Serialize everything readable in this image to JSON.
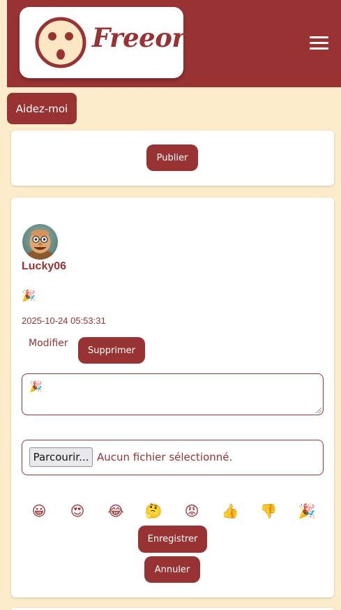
{
  "header": {
    "brand": "Freeora",
    "background": "#993233",
    "menu_icon": "hamburger-icon"
  },
  "help_button": {
    "label": "Aidez-moi"
  },
  "composer": {
    "publish_label": "Publier"
  },
  "post": {
    "username": "Lucky06",
    "content": "🎉",
    "timestamp": "2025-10-24 05:53:31",
    "modify_label": "Modifier",
    "delete_label": "Supprimer",
    "edit_value": "🎉",
    "file_button_label": "Parcourir...",
    "file_status": "Aucun fichier sélectionné.",
    "emojis": [
      "😀",
      "😍",
      "😂",
      "🤔",
      "😡",
      "👍",
      "👎",
      "🎉"
    ],
    "save_label": "Enregistrer",
    "cancel_label": "Annuler"
  },
  "colors": {
    "accent": "#993233",
    "page_background": "#fdeccb",
    "card_background": "#ffffff"
  }
}
